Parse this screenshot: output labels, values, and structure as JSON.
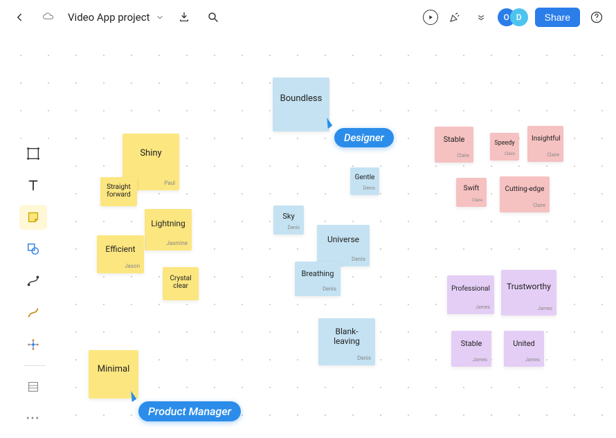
{
  "header": {
    "title": "Video App project",
    "share_label": "Share",
    "avatars": {
      "a": "O",
      "b": "D"
    }
  },
  "cursors": {
    "designer": "Designer",
    "pm": "Product Manager"
  },
  "notes": {
    "boundless": {
      "label": "Boundless",
      "author": ""
    },
    "shiny": {
      "label": "Shiny",
      "author": "Paul"
    },
    "straight": {
      "label": "Straight forward",
      "author": ""
    },
    "lightning": {
      "label": "Lightning",
      "author": "Jasmine"
    },
    "efficient": {
      "label": "Efficient",
      "author": "Jason"
    },
    "crystal": {
      "label": "Crystal clear",
      "author": ""
    },
    "minimal": {
      "label": "Minimal",
      "author": ""
    },
    "gentle": {
      "label": "Gentle",
      "author": "Denis"
    },
    "sky": {
      "label": "Sky",
      "author": "Denis"
    },
    "universe": {
      "label": "Universe",
      "author": "Denis"
    },
    "breathing": {
      "label": "Breathing",
      "author": "Denis"
    },
    "blank": {
      "label": "Blank-leaving",
      "author": "Denis"
    },
    "stable1": {
      "label": "Stable",
      "author": "Claire"
    },
    "speedy": {
      "label": "Speedy",
      "author": "Claire"
    },
    "insightful": {
      "label": "Insightful",
      "author": "Claire"
    },
    "swift": {
      "label": "Swift",
      "author": "Claire"
    },
    "cutting": {
      "label": "Cutting-edge",
      "author": "Claire"
    },
    "professional": {
      "label": "Professional",
      "author": "James"
    },
    "trustworthy": {
      "label": "Trustworthy",
      "author": "James"
    },
    "stable2": {
      "label": "Stable",
      "author": "James"
    },
    "united": {
      "label": "United",
      "author": "James"
    }
  }
}
